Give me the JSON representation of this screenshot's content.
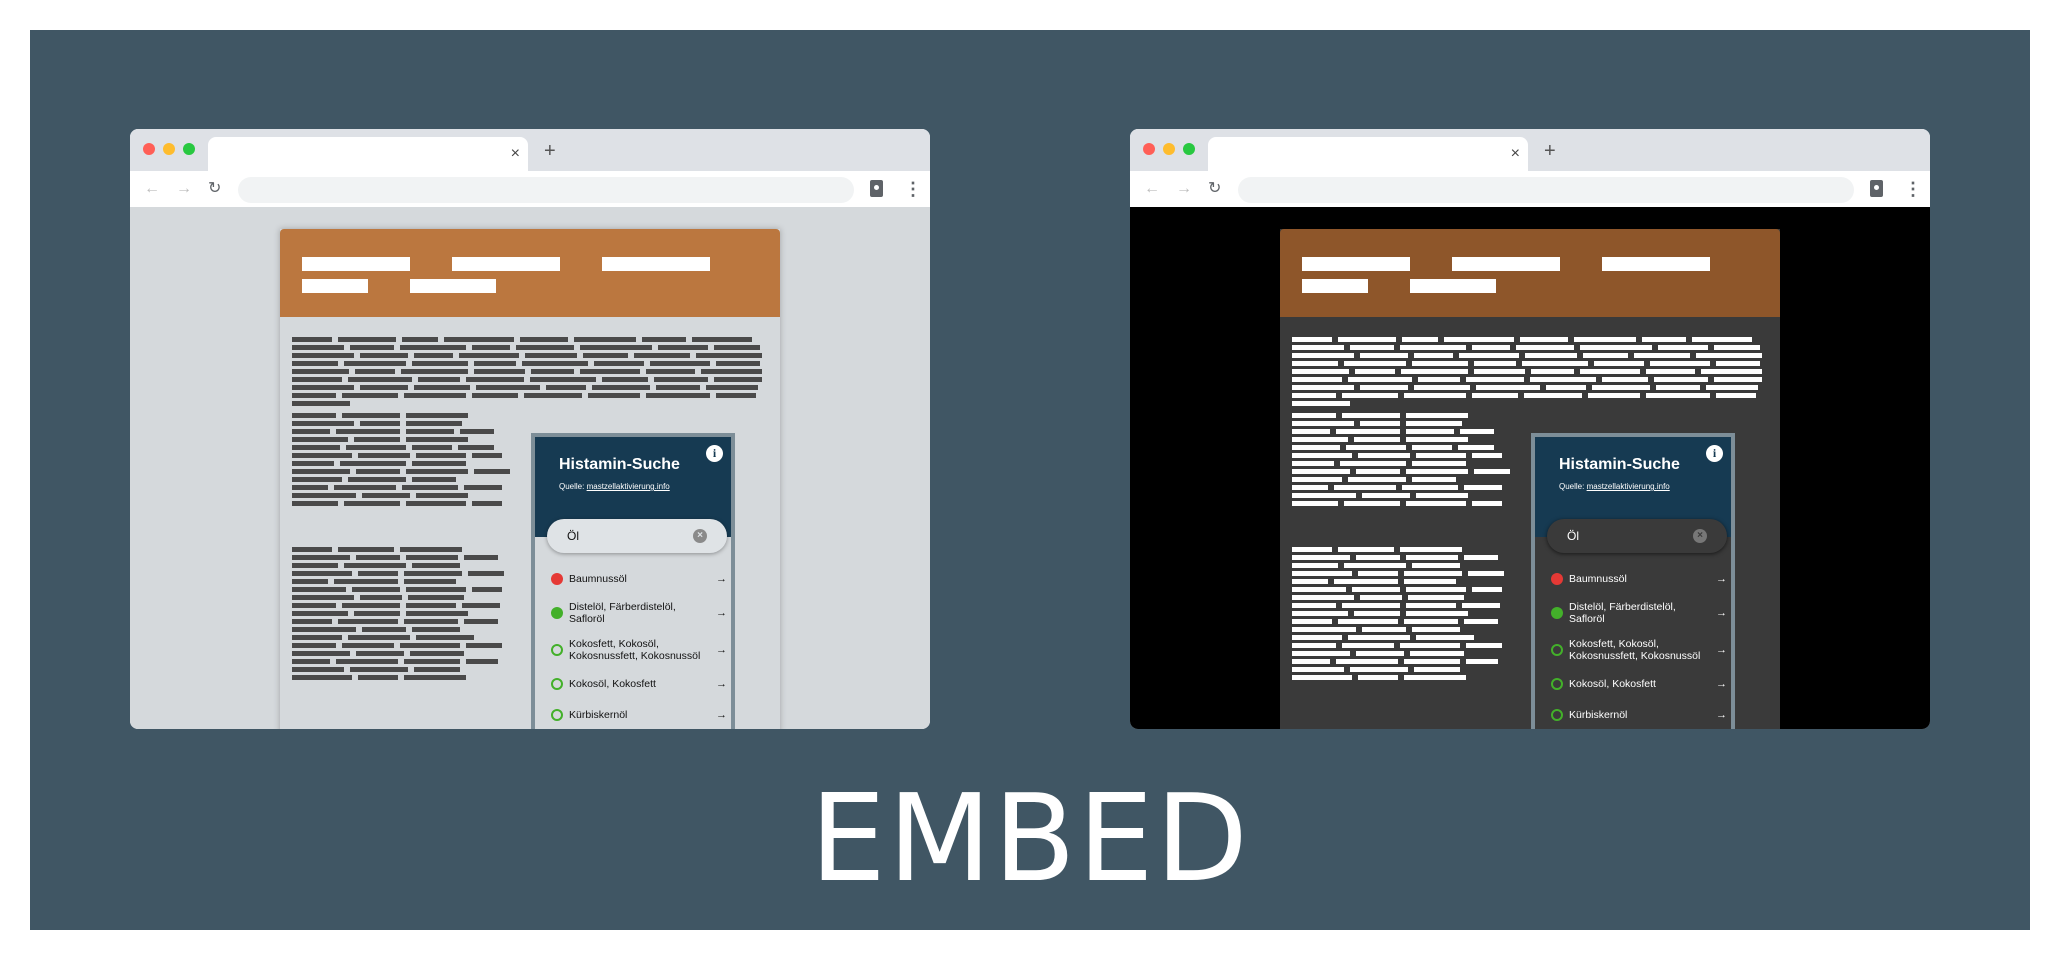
{
  "caption": "EMBED",
  "colors": {
    "stage_background": "#405664",
    "light_page_background": "#d5d9dc",
    "dark_page_background": "#000000",
    "light_header": "#bb773f",
    "dark_header": "#8e562a",
    "widget_header": "#163a52",
    "widget_border": "#7d8e98",
    "status_red": "#e53935",
    "status_green": "#43b02a"
  },
  "browser_chrome": {
    "tab_close_icon": "×",
    "new_tab_icon": "+",
    "back_icon": "←",
    "forward_icon": "→",
    "reload_icon": "↻",
    "menu_icon": "⋮"
  },
  "widget": {
    "title": "Histamin-Suche",
    "source_label": "Quelle:",
    "source_link": "mastzellaktivierung.info",
    "info_icon": "i",
    "search_value": "Öl",
    "clear_icon": "×",
    "results": [
      {
        "label": "Baumnussöl",
        "status": "red-filled",
        "arrow": "→"
      },
      {
        "label": "Distelöl, Färberdistelöl, Safloröl",
        "status": "green-filled",
        "arrow": "→"
      },
      {
        "label": "Kokosfett, Kokosöl, Kokosnussfett, Kokosnussöl",
        "status": "green-ring",
        "arrow": "→"
      },
      {
        "label": "Kokosöl, Kokosfett",
        "status": "green-ring",
        "arrow": "→"
      },
      {
        "label": "Kürbiskernöl",
        "status": "green-ring",
        "arrow": "→"
      }
    ]
  }
}
